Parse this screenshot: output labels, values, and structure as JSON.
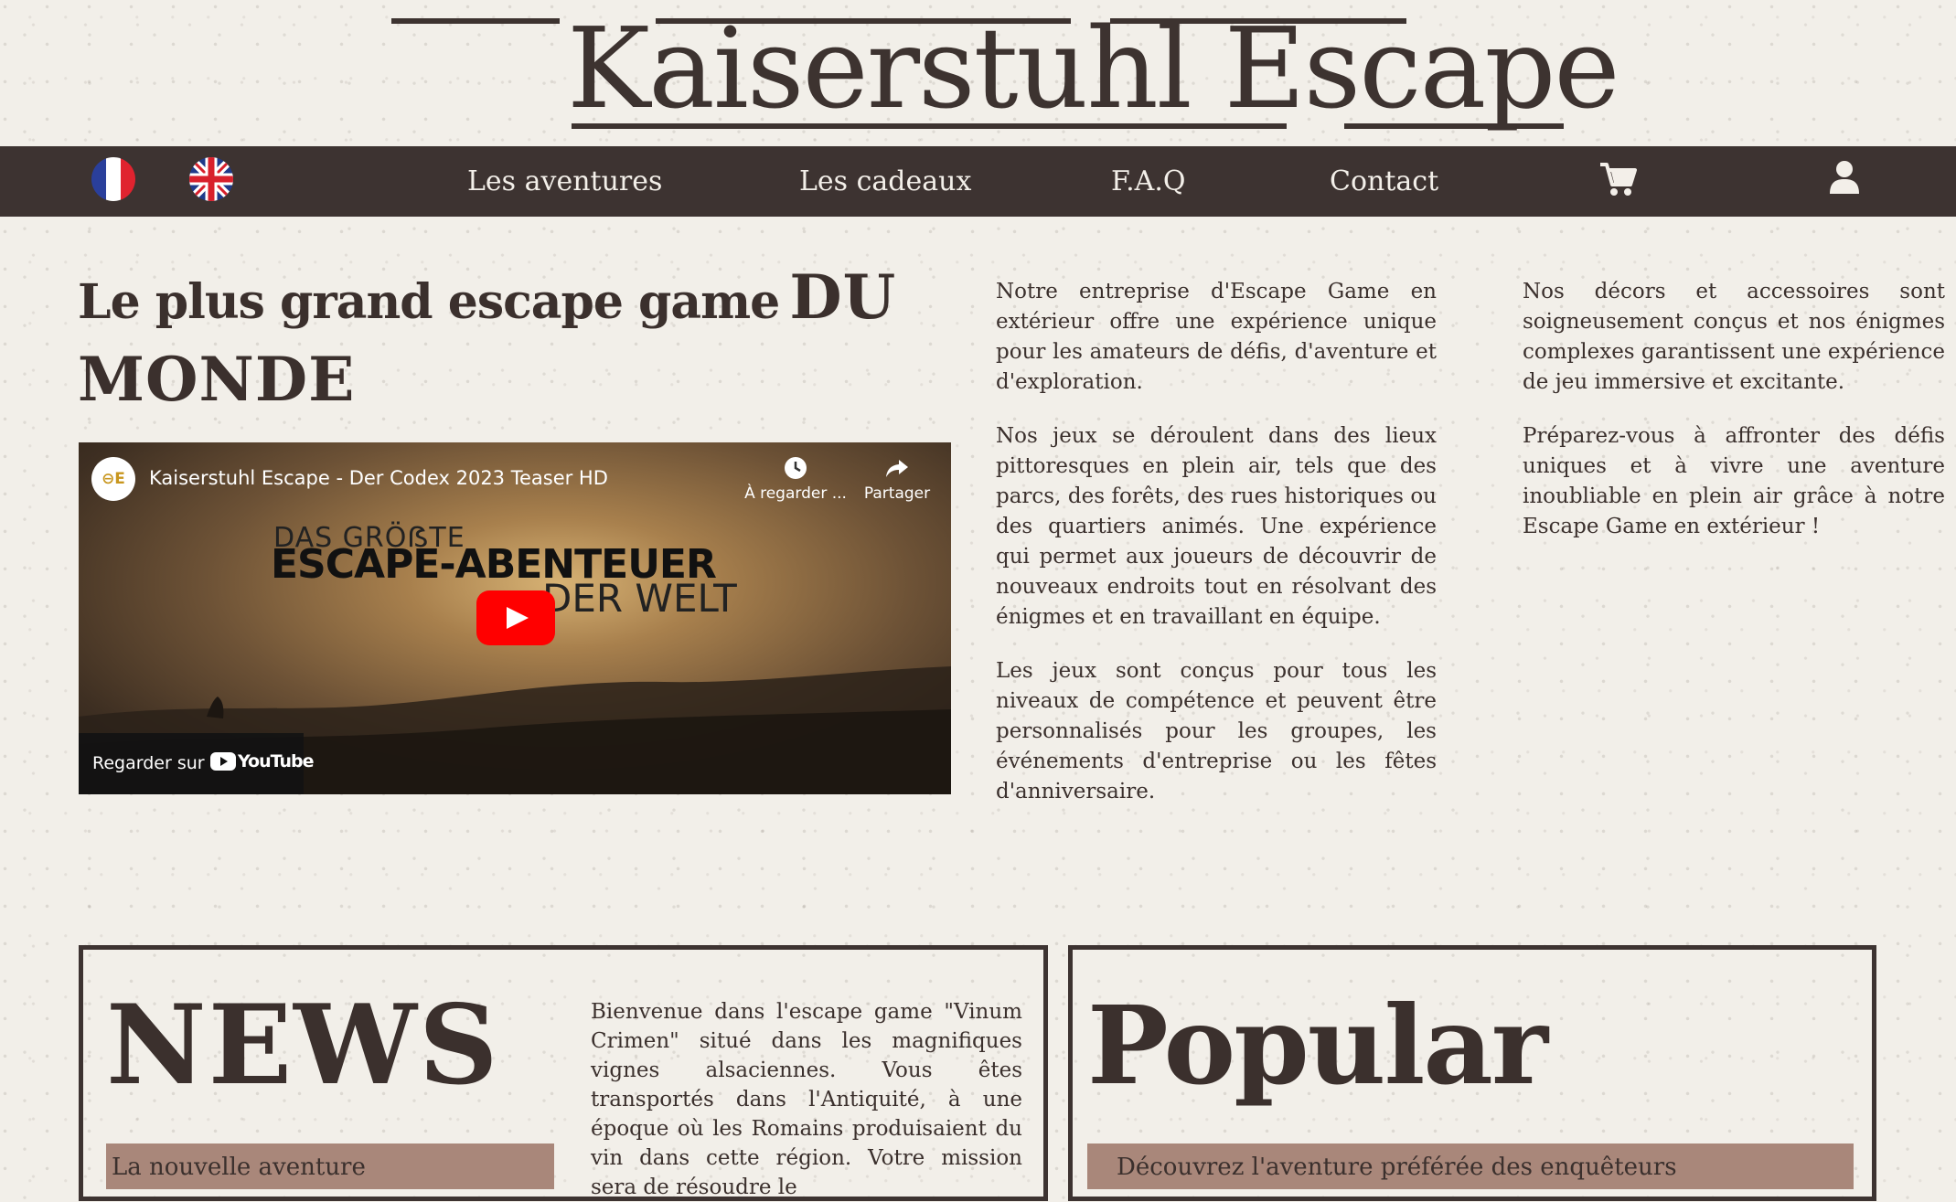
{
  "header": {
    "logo_text": "Kaiserstuhl Escape"
  },
  "nav": {
    "lang_fr": "fr-flag-icon",
    "lang_en": "uk-flag-icon",
    "links": [
      "Les aventures",
      "Les cadeaux",
      "F.A.Q",
      "Contact"
    ],
    "cart": "cart-icon",
    "account": "user-icon",
    "bg_color": "#3d3331",
    "text_color": "#f3efe9"
  },
  "hero": {
    "title_part1": "Le plus grand escape game",
    "title_part2": "DU",
    "title_part3": "MONDE"
  },
  "video": {
    "channel_icon_text": "⊖E",
    "title": "Kaiserstuhl Escape - Der Codex 2023 Teaser HD",
    "watch_later": "À regarder ...",
    "share": "Partager",
    "overline": "DAS GRÖẞTE",
    "headline": "ESCAPE-ABENTEUER",
    "subline": "DER WELT",
    "watch_on": "Regarder sur",
    "yt_word": "YouTube"
  },
  "intro": {
    "middle": [
      "Notre entreprise d'Escape Game en extérieur offre une expérience unique pour les amateurs de défis, d'aventure et d'exploration.",
      "Nos jeux se déroulent dans des lieux pittoresques en plein air, tels que des parcs, des forêts, des rues historiques ou des quartiers animés. Une expérience qui permet aux joueurs de découvrir de nouveaux endroits tout en résolvant des énigmes et en travaillant en équipe.",
      "Les jeux sont conçus pour tous les niveaux de compétence et peuvent être personnalisés pour les groupes, les événements d'entreprise ou les fêtes d'anniversaire."
    ],
    "right": [
      "Nos décors et accessoires sont soigneusement conçus et nos énigmes complexes garantissent une expérience de jeu immersive et excitante.",
      "Préparez-vous à affronter des défis uniques et à vivre une aventure inoubliable en plein air grâce à notre Escape Game en extérieur !"
    ]
  },
  "news": {
    "heading": "NEWS",
    "banner": "La nouvelle aventure",
    "text": "Bienvenue dans l'escape game \"Vinum Crimen\" situé dans les magnifiques vignes alsaciennes. Vous êtes transportés dans l'Antiquité, à une époque où les Romains produisaient du vin dans cette région. Votre mission sera de résoudre le"
  },
  "popular": {
    "heading": "Popular",
    "banner": "Découvrez l'aventure préférée des enquêteurs"
  },
  "colors": {
    "background": "#f2efe9",
    "text": "#3b302d",
    "banner": "#a9877a"
  }
}
